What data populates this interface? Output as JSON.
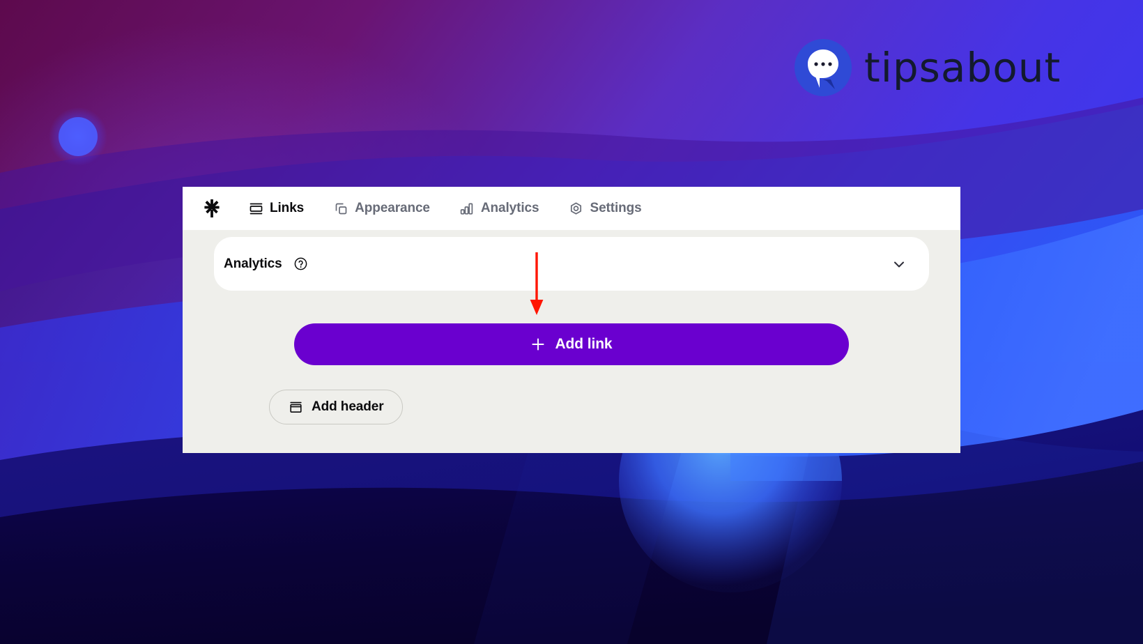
{
  "brand": {
    "name": "tipsabout",
    "logo_icon": "speech-bubble-icon",
    "logo_color": "#2f4ad6",
    "text_color": "#131a2e"
  },
  "app": {
    "logo_icon": "linktree-asterisk-icon",
    "nav": {
      "tabs": [
        {
          "label": "Links",
          "icon": "links-icon",
          "active": true
        },
        {
          "label": "Appearance",
          "icon": "appearance-icon",
          "active": false
        },
        {
          "label": "Analytics",
          "icon": "analytics-icon",
          "active": false
        },
        {
          "label": "Settings",
          "icon": "settings-icon",
          "active": false
        }
      ]
    },
    "analytics_panel": {
      "title": "Analytics",
      "help_icon": "question-mark-circle-icon",
      "expand_icon": "chevron-down-icon"
    },
    "actions": {
      "add_link": {
        "label": "Add link",
        "icon": "plus-icon",
        "background": "#6a00cf",
        "text_color": "#ffffff"
      },
      "add_header": {
        "label": "Add header",
        "icon": "header-block-icon",
        "border_color": "#c9c9c3",
        "text_color": "#0b0b0d"
      }
    },
    "surface_colors": {
      "nav_background": "#ffffff",
      "body_background": "#efefeb",
      "panel_background": "#ffffff"
    }
  },
  "annotation": {
    "type": "arrow",
    "direction": "down",
    "color": "#ff1500",
    "points_to": "Add link"
  },
  "background": {
    "style": "abstract-gradient-waves",
    "colors": {
      "magenta": "#6c0b54",
      "purple": "#5a1a9e",
      "violet": "#6a3ce0",
      "blue": "#2f55f0",
      "bright_blue": "#3d6dff",
      "navy": "#0d0340",
      "deep_navy": "#090230"
    }
  }
}
